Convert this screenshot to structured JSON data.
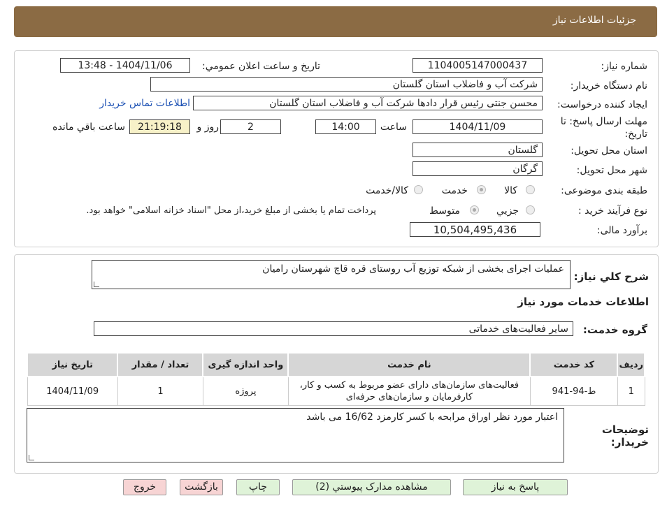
{
  "header": {
    "title": "جزئیات اطلاعات نیاز"
  },
  "form": {
    "need_no_label": "شماره نیاز:",
    "need_no_value": "1104005147000437",
    "announce_label": "تاریخ و ساعت اعلان عمومي:",
    "announce_value": "1404/11/06 - 13:48",
    "buyer_label": "نام دستگاه خريدار:",
    "buyer_value": "شرکت آب و فاضلاب استان گلستان",
    "creator_label": "ایجاد کننده درخواست:",
    "creator_value": "محسن جنتی رئیس قرار دادها شرکت آب و فاضلاب استان گلستان",
    "contact_link": "اطلاعات تماس خريدار",
    "deadline_label_1": "مهلت ارسال پاسخ: تا",
    "deadline_label_2": "تاریخ:",
    "deadline_date": "1404/11/09",
    "time_label": "ساعت",
    "deadline_time": "14:00",
    "days_value": "2",
    "days_label": "روز و",
    "remaining_value": "21:19:18",
    "remaining_label": "ساعت باقي مانده",
    "province_label": "استان محل تحویل:",
    "province_value": "گلستان",
    "city_label": "شهر محل تحویل:",
    "city_value": "گرگان",
    "category_label": "طبقه بندی موضوعی:",
    "category_options": [
      "کالا",
      "خدمت",
      "کالا/خدمت"
    ],
    "process_label": "نوع فرآیند خرید :",
    "process_options": [
      "جزيي",
      "متوسط"
    ],
    "process_note": "پرداخت تمام یا بخشی از مبلغ خرید،از محل \"اسناد خزانه اسلامی\" خواهد بود.",
    "budget_label": "برآورد مالی:",
    "budget_value": "10,504,495,436"
  },
  "description": {
    "label": "شرح کلي نياز:",
    "value": "عملیات اجرای بخشی از شبکه توزیع آب روستای قره قاچ شهرستان رامیان"
  },
  "services": {
    "section_title": "اطلاعات خدمات مورد نیاز",
    "group_label": "گروه خدمت:",
    "group_value": "سایر فعالیت‌های خدماتی",
    "columns": [
      "رديف",
      "کد خدمت",
      "نام خدمت",
      "واحد اندازه گیری",
      "تعداد / مقدار",
      "تاریخ نیاز"
    ],
    "rows": [
      {
        "row": "1",
        "code": "ط-94-941",
        "name_1": "فعالیت‌های سازمان‌های دارای عضو مربوط به کسب و کار،",
        "name_2": "کارفرمایان و سازمان‌های حرفه‌ای",
        "unit": "پروژه",
        "qty": "1",
        "date": "1404/11/09"
      }
    ]
  },
  "buyer_notes": {
    "label_1": "توضیحات",
    "label_2": "خریدار:",
    "value": "اعتبار مورد نظر اوراق مرابحه با کسر کارمزد 16/62 می باشد"
  },
  "buttons": {
    "reply": "پاسخ به نیاز",
    "attachments": "مشاهده مدارک پیوستي (2)",
    "print": "چاپ",
    "back": "بازگشت",
    "exit": "خروج"
  },
  "colors": {
    "header_bg": "#8b6b44",
    "remaining_bg": "#f7f1c8",
    "green_btn": "#dff3d8",
    "pink_btn": "#f7d4d4"
  }
}
